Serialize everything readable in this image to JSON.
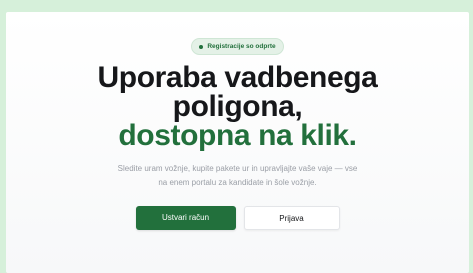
{
  "badge": {
    "label": "Registracije so odprte",
    "icon": "dot-icon"
  },
  "headline": {
    "line1": "Uporaba vadbenega",
    "line2": "poligona,",
    "accent": "dostopna na klik."
  },
  "subtitle": {
    "line1": "Sledite uram vožnje, kupite pakete ur in upravljajte vaše vaje — vse",
    "line2": "na enem portalu za kandidate in šole vožnje."
  },
  "actions": {
    "primary": "Ustvari račun",
    "secondary": "Prijava"
  },
  "colors": {
    "brand": "#22703c",
    "heading": "#16171a",
    "muted": "#9a9ea6",
    "page_background": "#d6f0da"
  }
}
